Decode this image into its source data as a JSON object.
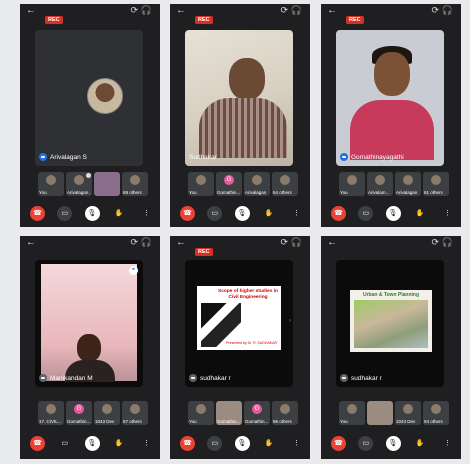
{
  "phones": [
    {
      "rec": "REC",
      "stage_name": "Arivalagan S",
      "thumbs": [
        "You",
        "Arivalagan...",
        "",
        "69 others"
      ],
      "controls": [
        "end-call-icon",
        "camera-off-icon",
        "mic-off-icon",
        "raise-hand-icon",
        "more-vert-icon"
      ]
    },
    {
      "rec": "REC",
      "stage_name": "Sudhakar",
      "thumbs": [
        "You",
        "Gomathin...",
        "Arivalagan",
        "64 others"
      ]
    },
    {
      "rec": "REC",
      "stage_name": "Gomathinayagathi",
      "thumbs": [
        "You",
        "Arivalam...",
        "Arivalagan",
        "61 others"
      ]
    },
    {
      "stage_name": "Manikandan M",
      "thumbs": [
        "17. CIVIL...",
        "Gomathin...",
        "1043 Dev",
        "57 others"
      ]
    },
    {
      "rec": "REC",
      "stage_name": "sudhakar r",
      "slide_title": "Scope of higher studies in Civil Engineering",
      "slide_presenter": "Presented by Dr. R. SUDHAKAR",
      "thumbs": [
        "You",
        "Gomathin...",
        "Gomathin...",
        "96 others"
      ]
    },
    {
      "stage_name": "sudhakar r",
      "slide_title": "Urban & Town Planning",
      "thumbs": [
        "You",
        "",
        "1043 Dev",
        "94 others"
      ]
    }
  ],
  "topbar": {
    "back_icon": "arrow-back-icon",
    "rotate_icon": "screen-rotate-icon",
    "audio_icon": "headphones-icon"
  },
  "colors": {
    "end_call": "#ea4335",
    "rec": "#d93025",
    "app_bg": "#1f1f21"
  }
}
